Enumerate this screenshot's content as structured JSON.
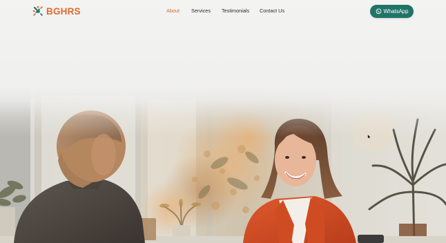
{
  "brand": {
    "name": "BGHRS",
    "color": "#e06a2c",
    "icon": "arrow-burst-logo-icon"
  },
  "nav": {
    "items": [
      {
        "label": "About",
        "active": true
      },
      {
        "label": "Services",
        "active": false
      },
      {
        "label": "Testimonials",
        "active": false
      },
      {
        "label": "Contact Us",
        "active": false
      }
    ],
    "active_color": "#d76b2c"
  },
  "cta": {
    "label": "WhatsApp",
    "icon": "whatsapp-icon",
    "color": "#1f7467"
  },
  "hero": {
    "image": "business-meeting-photo"
  }
}
